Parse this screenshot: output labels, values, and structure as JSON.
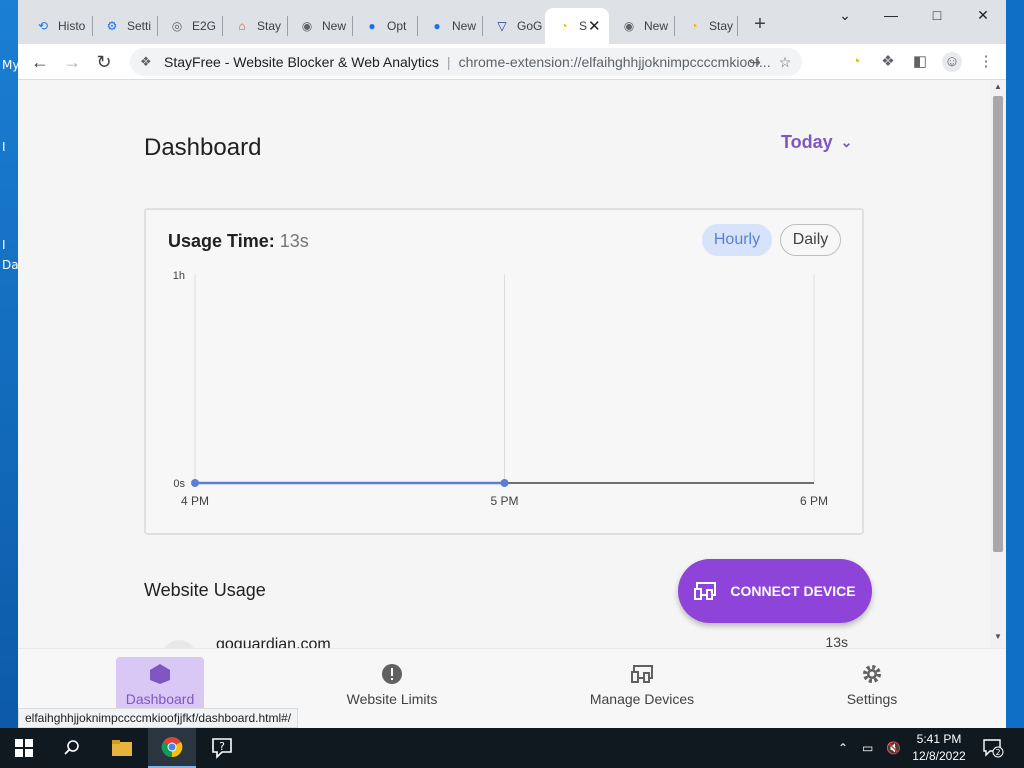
{
  "desktop": {
    "labels": [
      "My",
      "I",
      "I",
      "Da"
    ]
  },
  "browser": {
    "tabs": [
      {
        "label": "Histo",
        "icon": "history-icon"
      },
      {
        "label": "Setti",
        "icon": "settings-icon"
      },
      {
        "label": "E2G",
        "icon": "globe-icon"
      },
      {
        "label": "Stay",
        "icon": "stayfree-icon"
      },
      {
        "label": "New",
        "icon": "chrome-icon"
      },
      {
        "label": "Opt",
        "icon": "globe-blue-icon"
      },
      {
        "label": "New",
        "icon": "globe-blue-icon"
      },
      {
        "label": "GoG",
        "icon": "shield-icon"
      },
      {
        "label": "S",
        "icon": "stayfree-icon"
      },
      {
        "label": "New",
        "icon": "chrome-icon"
      },
      {
        "label": "Stay",
        "icon": "stayfree-icon"
      }
    ],
    "omnibox": {
      "title": "StayFree - Website Blocker & Web Analytics",
      "url": "chrome-extension://elfaihghhjjoknimpccccmkioof..."
    },
    "status_url": "elfaihghhjjoknimpccccmkioofjjfkf/dashboard.html#/"
  },
  "page": {
    "title": "Dashboard",
    "range": "Today",
    "usage": {
      "label": "Usage Time:",
      "value": "13s",
      "toggle_hourly": "Hourly",
      "toggle_daily": "Daily"
    },
    "section_title": "Website Usage",
    "connect_device": "CONNECT DEVICE",
    "usage_rows": [
      {
        "site": "goguardian.com",
        "time": "13s"
      }
    ],
    "bottom_nav": {
      "dashboard": "Dashboard",
      "limits": "Website Limits",
      "devices": "Manage Devices",
      "settings": "Settings"
    }
  },
  "chart_data": {
    "type": "line",
    "x": [
      "4 PM",
      "5 PM",
      "6 PM"
    ],
    "y_ticks": [
      "0s",
      "1h"
    ],
    "series": [
      {
        "values": [
          0,
          0
        ]
      }
    ],
    "ylim": [
      0,
      3600
    ],
    "grid": "vertical",
    "color": "#5c7ed6"
  },
  "taskbar": {
    "clock_time": "5:41 PM",
    "clock_date": "12/8/2022",
    "notification_count": "2"
  },
  "colors": {
    "accent": "#7e57c2",
    "fab": "#8e44d8",
    "line": "#5c7ed6"
  }
}
